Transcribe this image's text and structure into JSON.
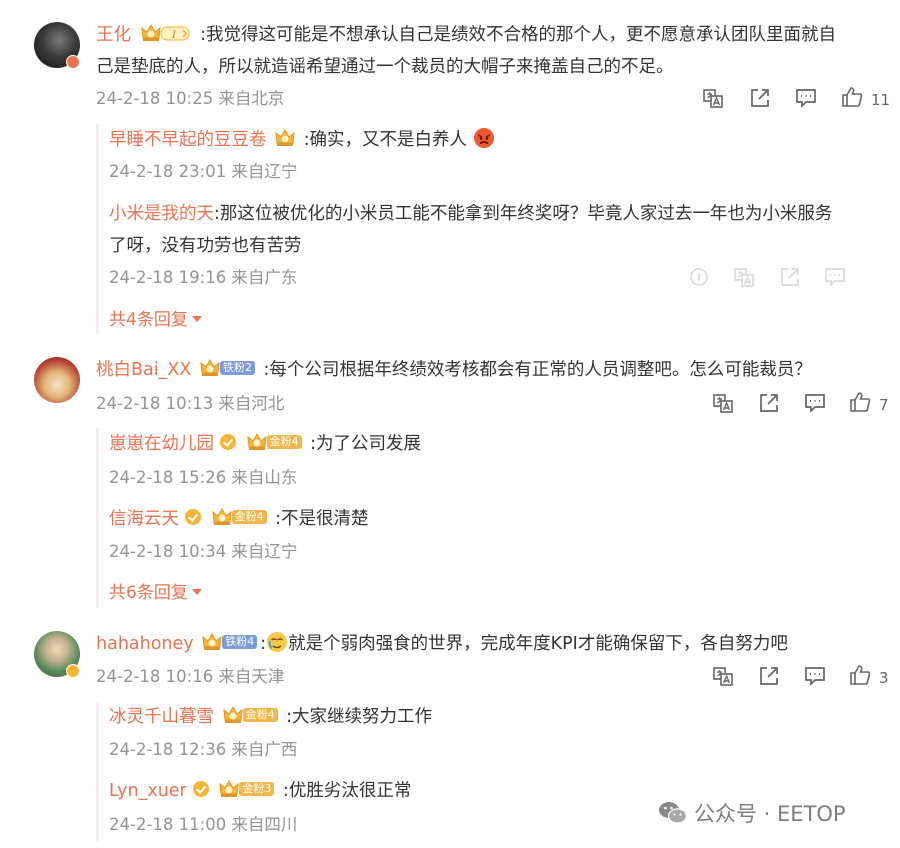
{
  "threads": [
    {
      "author": "王化",
      "text": ":我觉得这可能是不想承认自己是绩效不合格的那个人，更不愿意承认团队里面就自",
      "text2": "己是垫底的人，所以就造谣希望通过一个裁员的大帽子来掩盖自己的不足。",
      "meta": "24-2-18 10:25 来自北京",
      "likes": "11",
      "replies": [
        {
          "author": "早睡不早起的豆豆卷",
          "text": ":确实，又不是白养人",
          "meta": "24-2-18 23:01 来自辽宁"
        },
        {
          "author": "小米是我的天",
          "text": ":那这位被优化的小米员工能不能拿到年终奖呀？毕竟人家过去一年也为小米服务",
          "text2": "了呀，没有功劳也有苦劳",
          "meta": "24-2-18 19:16 来自广东"
        }
      ],
      "more": "共4条回复"
    },
    {
      "author": "桃白Bai_XX",
      "badge": "铁粉2",
      "text": ":每个公司根据年终绩效考核都会有正常的人员调整吧。怎么可能裁员？",
      "meta": "24-2-18 10:13 来自河北",
      "likes": "7",
      "replies": [
        {
          "author": "崽崽在幼儿园",
          "badge": "金粉4",
          "text": ":为了公司发展",
          "meta": "24-2-18 15:26 来自山东"
        },
        {
          "author": "信海云天",
          "badge": "金粉4",
          "text": ":不是很清楚",
          "meta": "24-2-18 10:34 来自辽宁"
        }
      ],
      "more": "共6条回复"
    },
    {
      "author": "hahahoney",
      "badge": "铁粉4",
      "text": "就是个弱肉强食的世界，完成年度KPI才能确保留下，各自努力吧",
      "meta": "24-2-18 10:16 来自天津",
      "likes": "3",
      "replies": [
        {
          "author": "冰灵千山暮雪",
          "badge": "金粉4",
          "text": ":大家继续努力工作",
          "meta": "24-2-18 12:36 来自广西"
        },
        {
          "author": "Lyn_xuer",
          "badge": "金粉3",
          "text": ":优胜劣汰很正常",
          "meta": "24-2-18 11:00 来自四川"
        }
      ]
    }
  ],
  "watermark": "公众号 · EETOP",
  "colors": {
    "name": "#eb7350",
    "meta": "#939393",
    "text": "#333333",
    "vip": "#f6b534"
  },
  "icons": [
    "translate-icon",
    "share-icon",
    "comment-icon",
    "like-icon",
    "emoji-angry-icon",
    "emoji-crying-icon",
    "wechat-icon"
  ]
}
